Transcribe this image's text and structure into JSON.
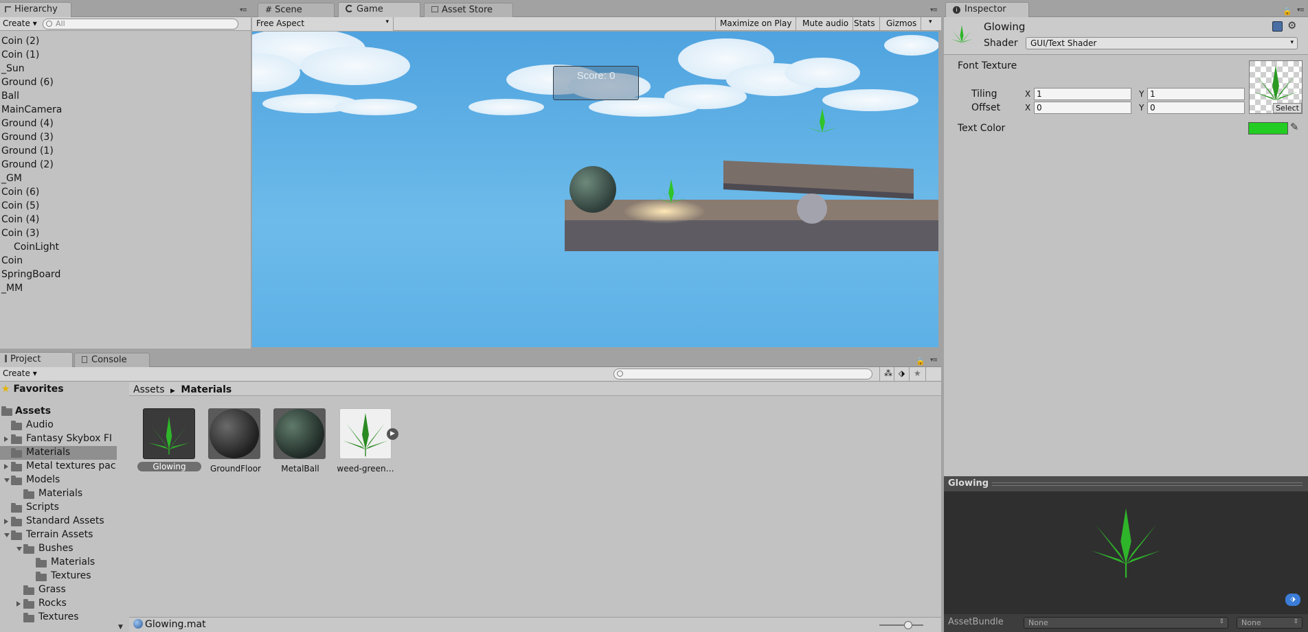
{
  "hierarchy": {
    "tab": "Hierarchy",
    "create": "Create",
    "search_placeholder": "All",
    "items": [
      "Coin (2)",
      "Coin (1)",
      "_Sun",
      "Ground (6)",
      "Ball",
      "MainCamera",
      "Ground (4)",
      "Ground (3)",
      "Ground (1)",
      "Ground (2)",
      "_GM",
      "Coin (6)",
      "Coin (5)",
      "Coin (4)",
      "Coin (3)",
      "CoinLight",
      "Coin",
      "SpringBoard",
      "_MM"
    ]
  },
  "center_tabs": [
    "Scene",
    "Game",
    "Asset Store"
  ],
  "game": {
    "aspect": "Free Aspect",
    "toolbar": [
      "Maximize on Play",
      "Mute audio",
      "Stats",
      "Gizmos"
    ],
    "score": "Score: 0"
  },
  "project": {
    "tabs": [
      "Project",
      "Console"
    ],
    "create": "Create",
    "favorites": "Favorites",
    "assets_root": "Assets",
    "tree": [
      "Audio",
      "Fantasy Skybox FI",
      "Materials",
      "Metal textures pac",
      "Models",
      "Materials",
      "Scripts",
      "Standard Assets",
      "Terrain Assets",
      "Bushes",
      "Materials",
      "Textures",
      "Grass",
      "Rocks",
      "Textures"
    ],
    "breadcrumb": [
      "Assets",
      "Materials"
    ],
    "assets": [
      "Glowing",
      "GroundFloor",
      "MetalBall",
      "weed-green…"
    ],
    "status_file": "Glowing.mat"
  },
  "inspector": {
    "tab": "Inspector",
    "name": "Glowing",
    "shader_label": "Shader",
    "shader_value": "GUI/Text Shader",
    "font_texture": "Font Texture",
    "tiling_label": "Tiling",
    "offset_label": "Offset",
    "tiling_x": "1",
    "tiling_y": "1",
    "offset_x": "0",
    "offset_y": "0",
    "select": "Select",
    "text_color_label": "Text Color",
    "text_color": "#22cc22",
    "x": "X",
    "y": "Y"
  },
  "preview": {
    "title": "Glowing",
    "assetbundle_label": "AssetBundle",
    "bundle_value": "None",
    "variant_value": "None"
  },
  "colors": {
    "leaf": "#2fb52a",
    "sky": "#5aaee6",
    "panel": "#c2c2c2",
    "preview_bg": "#2f2f2f"
  }
}
